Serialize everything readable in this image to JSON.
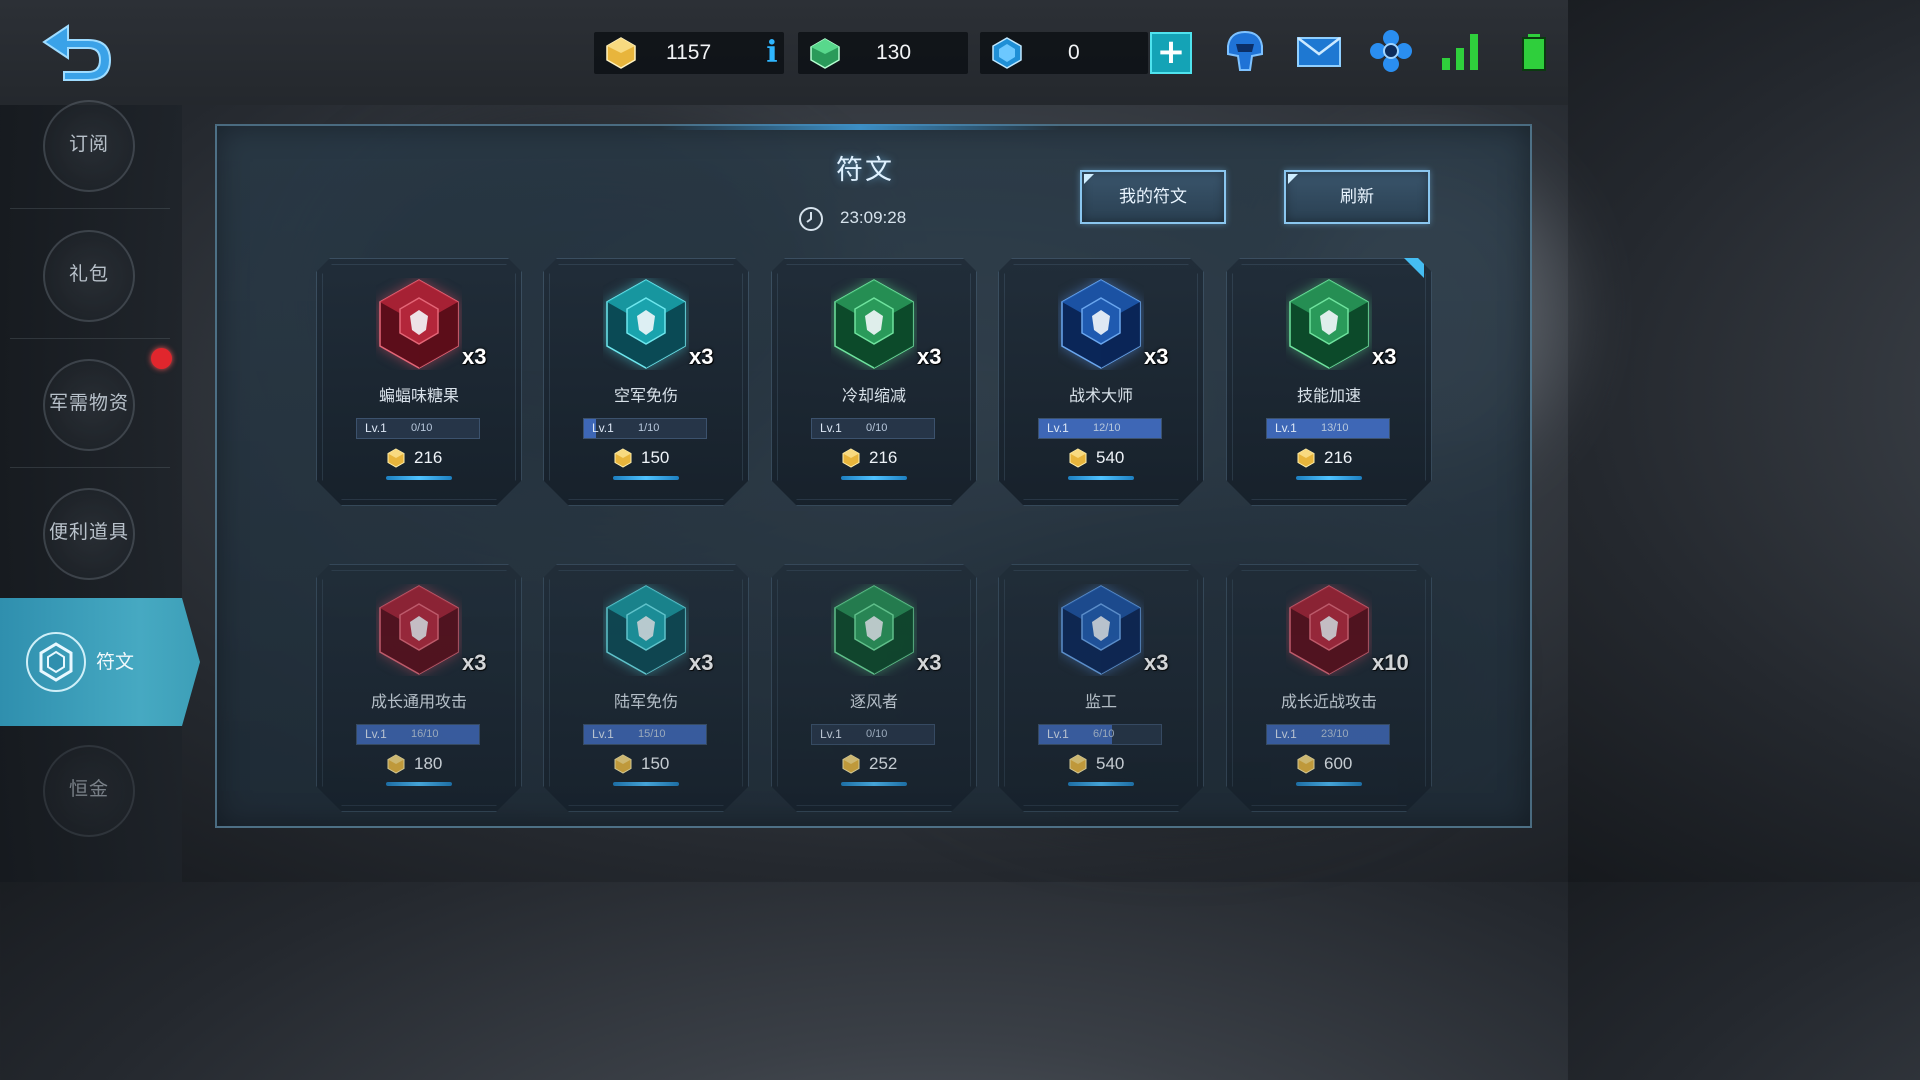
{
  "topbar": {
    "gold": "1157",
    "green_gem": "130",
    "blue_gem": "0",
    "info_label": "i",
    "plus_label": "+",
    "icons": [
      "back-arrow-icon",
      "gold-crystal-icon",
      "green-gem-icon",
      "blue-gem-icon",
      "info-icon",
      "plus-icon",
      "helmet-icon",
      "mail-icon",
      "settings-flower-icon",
      "signal-icon",
      "battery-icon"
    ]
  },
  "sidebar": {
    "items": [
      {
        "label": "订阅"
      },
      {
        "label": "礼包"
      },
      {
        "label": "军需物资"
      },
      {
        "label": "便利道具"
      },
      {
        "label": "符文"
      },
      {
        "label": "恒金"
      }
    ],
    "active_index": 4
  },
  "panel": {
    "title": "符文",
    "timer": "23:09:28",
    "my_runes_label": "我的符文",
    "refresh_label": "刷新"
  },
  "cards": [
    {
      "name": "蝙蝠味糖果",
      "count": "x3",
      "level": "Lv.1",
      "progress": "0/10",
      "fill_pct": 0,
      "price": "216",
      "color": "red",
      "icon": "bat-icon"
    },
    {
      "name": "空军免伤",
      "count": "x3",
      "level": "Lv.1",
      "progress": "1/10",
      "fill_pct": 10,
      "price": "150",
      "color": "cyan",
      "icon": "shield-wing-icon"
    },
    {
      "name": "冷却缩减",
      "count": "x3",
      "level": "Lv.1",
      "progress": "0/10",
      "fill_pct": 0,
      "price": "216",
      "color": "green",
      "icon": "hourglass-icon"
    },
    {
      "name": "战术大师",
      "count": "x3",
      "level": "Lv.1",
      "progress": "12/10",
      "fill_pct": 100,
      "price": "540",
      "color": "blue",
      "icon": "tactics-cube-icon"
    },
    {
      "name": "技能加速",
      "count": "x3",
      "level": "Lv.1",
      "progress": "13/10",
      "fill_pct": 100,
      "price": "216",
      "color": "green",
      "icon": "potion-icon",
      "new": true
    },
    {
      "name": "成长通用攻击",
      "count": "x3",
      "level": "Lv.1",
      "progress": "16/10",
      "fill_pct": 100,
      "price": "180",
      "color": "red",
      "icon": "rifle-icon"
    },
    {
      "name": "陆军免伤",
      "count": "x3",
      "level": "Lv.1",
      "progress": "15/10",
      "fill_pct": 100,
      "price": "150",
      "color": "cyan",
      "icon": "helmet-shield-icon"
    },
    {
      "name": "逐风者",
      "count": "x3",
      "level": "Lv.1",
      "progress": "0/10",
      "fill_pct": 0,
      "price": "252",
      "color": "green",
      "icon": "wind-blade-icon"
    },
    {
      "name": "监工",
      "count": "x3",
      "level": "Lv.1",
      "progress": "6/10",
      "fill_pct": 60,
      "price": "540",
      "color": "blue",
      "icon": "overseer-horns-icon"
    },
    {
      "name": "成长近战攻击",
      "count": "x10",
      "level": "Lv.1",
      "progress": "23/10",
      "fill_pct": 100,
      "price": "600",
      "color": "red",
      "icon": "crossed-swords-icon"
    }
  ],
  "colors": {
    "accent_cyan": "#46a9c2",
    "gold": "#e8b53c",
    "red_gem": "#b3263a",
    "cyan_gem": "#1aa3ad",
    "green_gem": "#2a9a5a",
    "blue_gem": "#1f5ab0",
    "progress_fill": "#3e67b6",
    "notification_red": "#e1262d"
  }
}
